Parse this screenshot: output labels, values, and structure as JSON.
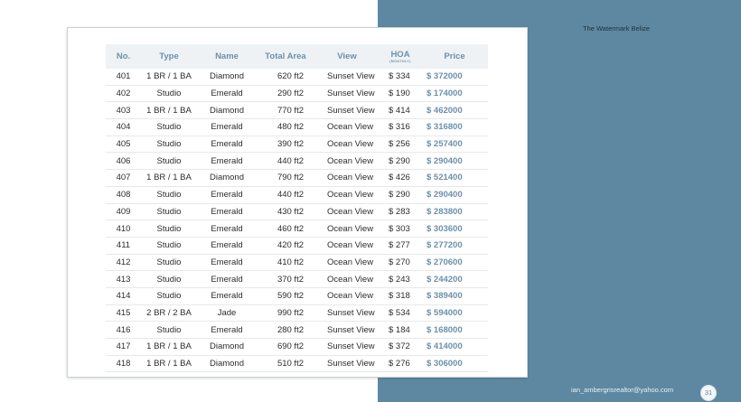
{
  "brand": "The Watermark Belize",
  "email": "ian_ambergrisrealtor@yahoo.com",
  "page_number": "31",
  "table": {
    "headers": {
      "no": "No.",
      "type": "Type",
      "name": "Name",
      "area": "Total Area",
      "view": "View",
      "hoa": "HOA",
      "hoa_sub": "(MONTHLY)",
      "price": "Price"
    },
    "rows": [
      {
        "no": "401",
        "type": "1 BR / 1 BA",
        "name": "Diamond",
        "area": "620 ft2",
        "view": "Sunset View",
        "hoa": "$ 334",
        "price": "$ 372000"
      },
      {
        "no": "402",
        "type": "Studio",
        "name": "Emerald",
        "area": "290 ft2",
        "view": "Sunset View",
        "hoa": "$ 190",
        "price": "$ 174000"
      },
      {
        "no": "403",
        "type": "1 BR / 1 BA",
        "name": "Diamond",
        "area": "770 ft2",
        "view": "Sunset View",
        "hoa": "$ 414",
        "price": "$ 462000"
      },
      {
        "no": "404",
        "type": "Studio",
        "name": "Emerald",
        "area": "480 ft2",
        "view": "Ocean View",
        "hoa": "$ 316",
        "price": "$ 316800"
      },
      {
        "no": "405",
        "type": "Studio",
        "name": "Emerald",
        "area": "390 ft2",
        "view": "Ocean View",
        "hoa": "$ 256",
        "price": "$ 257400"
      },
      {
        "no": "406",
        "type": "Studio",
        "name": "Emerald",
        "area": "440 ft2",
        "view": "Ocean View",
        "hoa": "$ 290",
        "price": "$ 290400"
      },
      {
        "no": "407",
        "type": "1 BR / 1 BA",
        "name": "Diamond",
        "area": "790 ft2",
        "view": "Ocean View",
        "hoa": "$ 426",
        "price": "$ 521400"
      },
      {
        "no": "408",
        "type": "Studio",
        "name": "Emerald",
        "area": "440 ft2",
        "view": "Ocean View",
        "hoa": "$ 290",
        "price": "$ 290400"
      },
      {
        "no": "409",
        "type": "Studio",
        "name": "Emerald",
        "area": "430 ft2",
        "view": "Ocean View",
        "hoa": "$ 283",
        "price": "$ 283800"
      },
      {
        "no": "410",
        "type": "Studio",
        "name": "Emerald",
        "area": "460 ft2",
        "view": "Ocean View",
        "hoa": "$ 303",
        "price": "$ 303600"
      },
      {
        "no": "411",
        "type": "Studio",
        "name": "Emerald",
        "area": "420 ft2",
        "view": "Ocean View",
        "hoa": "$ 277",
        "price": "$ 277200"
      },
      {
        "no": "412",
        "type": "Studio",
        "name": "Emerald",
        "area": "410 ft2",
        "view": "Ocean View",
        "hoa": "$ 270",
        "price": "$ 270600"
      },
      {
        "no": "413",
        "type": "Studio",
        "name": "Emerald",
        "area": "370 ft2",
        "view": "Ocean View",
        "hoa": "$ 243",
        "price": "$ 244200"
      },
      {
        "no": "414",
        "type": "Studio",
        "name": "Emerald",
        "area": "590 ft2",
        "view": "Ocean View",
        "hoa": "$ 318",
        "price": "$ 389400"
      },
      {
        "no": "415",
        "type": "2 BR / 2 BA",
        "name": "Jade",
        "area": "990 ft2",
        "view": "Sunset View",
        "hoa": "$ 534",
        "price": "$ 594000"
      },
      {
        "no": "416",
        "type": "Studio",
        "name": "Emerald",
        "area": "280 ft2",
        "view": "Sunset View",
        "hoa": "$ 184",
        "price": "$ 168000"
      },
      {
        "no": "417",
        "type": "1 BR / 1 BA",
        "name": "Diamond",
        "area": "690 ft2",
        "view": "Sunset View",
        "hoa": "$ 372",
        "price": "$ 414000"
      },
      {
        "no": "418",
        "type": "1 BR / 1 BA",
        "name": "Diamond",
        "area": "510 ft2",
        "view": "Sunset View",
        "hoa": "$ 276",
        "price": "$ 306000"
      }
    ]
  }
}
